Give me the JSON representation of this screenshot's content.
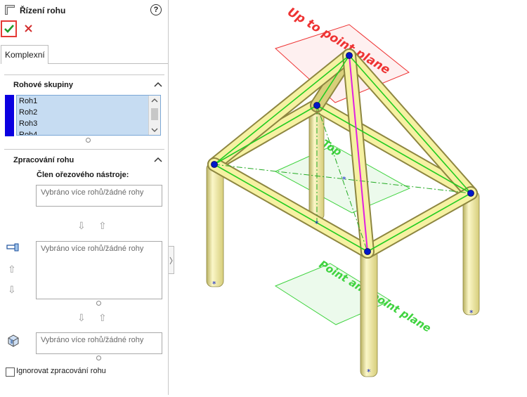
{
  "panel": {
    "title": "Řízení rohu",
    "tab_label": "Komplexní",
    "groups_section": {
      "title": "Rohové skupiny",
      "items": [
        "Roh1",
        "Roh2",
        "Roh3",
        "Roh4"
      ]
    },
    "processing_section": {
      "title": "Zpracování rohu",
      "trim_tool_label": "Člen ořezového nástroje:",
      "field1_placeholder": "Vybráno více rohů/žádné rohy",
      "field2_placeholder": "Vybráno více rohů/žádné rohy",
      "field3_placeholder": "Vybráno více rohů/žádné rohy"
    },
    "ignore_checkbox_label": "Ignorovat zpracování rohu"
  },
  "viewport": {
    "plane_labels": {
      "top_plane": "Up to point plane",
      "middle_plane": "Top",
      "bottom_plane": "Point and point plane"
    }
  },
  "colors": {
    "accept": "#1e9a2a",
    "cancel": "#d32f2f",
    "highlight_box": "#e53935",
    "group_swatch": "#0b00e0",
    "list_selection": "#c6dcf2",
    "tube": "#f6f1a2",
    "plane_green": "#3fd33f",
    "plane_red": "#ee3333",
    "sketch_magenta": "#e020e0"
  }
}
